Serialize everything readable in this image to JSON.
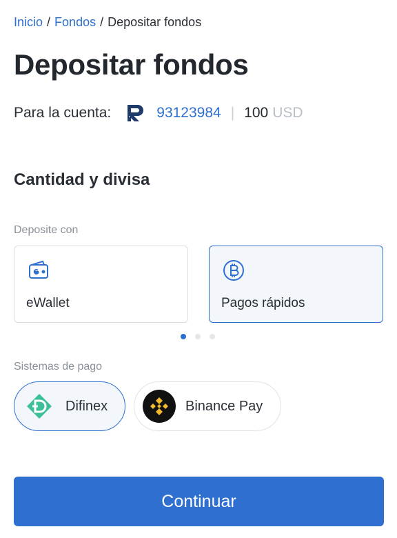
{
  "breadcrumb": {
    "items": [
      "Inicio",
      "Fondos",
      "Depositar fondos"
    ],
    "separator": "/"
  },
  "page_title": "Depositar fondos",
  "account": {
    "label": "Para la cuenta:",
    "logo_icon": "roboforex-logo-icon",
    "number": "93123984",
    "divider": "|",
    "balance": "100",
    "currency": "USD"
  },
  "section": {
    "title": "Cantidad y divisa",
    "deposit_with_label": "Deposite con",
    "methods": [
      {
        "label": "eWallet",
        "icon": "wallet-icon",
        "selected": false
      },
      {
        "label": "Pagos rápidos",
        "icon": "bitcoin-icon",
        "selected": true
      }
    ],
    "pagination": {
      "total": 3,
      "active": 1
    },
    "payment_systems_label": "Sistemas de pago",
    "payment_systems": [
      {
        "label": "Difinex",
        "icon": "difinex-logo-icon",
        "selected": true
      },
      {
        "label": "Binance Pay",
        "icon": "binance-logo-icon",
        "selected": false
      }
    ]
  },
  "continue_label": "Continuar",
  "colors": {
    "accent": "#2e6fd0",
    "selected_bg": "#f3f6fb",
    "difinex": "#3dbf9a",
    "binance_bg": "#111111",
    "binance_gold": "#f3ba2f"
  }
}
